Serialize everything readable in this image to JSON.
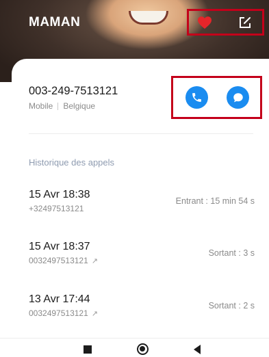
{
  "header": {
    "contact_name": "MAMAN",
    "favorite_icon": "heart-icon",
    "edit_icon": "edit-icon"
  },
  "contact": {
    "phone_number": "003-249-7513121",
    "phone_type": "Mobile",
    "country": "Belgique",
    "call_icon": "phone-icon",
    "message_icon": "chat-bubble-icon"
  },
  "history": {
    "title": "Historique des appels",
    "calls": [
      {
        "datetime": "15 Avr 18:38",
        "number": "+32497513121",
        "direction_arrow": "",
        "duration": "Entrant : 15 min 54 s"
      },
      {
        "datetime": "15 Avr 18:37",
        "number": "0032497513121",
        "direction_arrow": "↗",
        "duration": "Sortant : 3 s"
      },
      {
        "datetime": "13 Avr 17:44",
        "number": "0032497513121",
        "direction_arrow": "↗",
        "duration": "Sortant : 2 s"
      }
    ]
  },
  "nav": {
    "recents_icon": "square-icon",
    "home_icon": "circle-icon",
    "back_icon": "back-triangle-icon"
  },
  "colors": {
    "accent": "#1a8cf0",
    "highlight_border": "#c4001a",
    "favorite": "#e5252a"
  }
}
